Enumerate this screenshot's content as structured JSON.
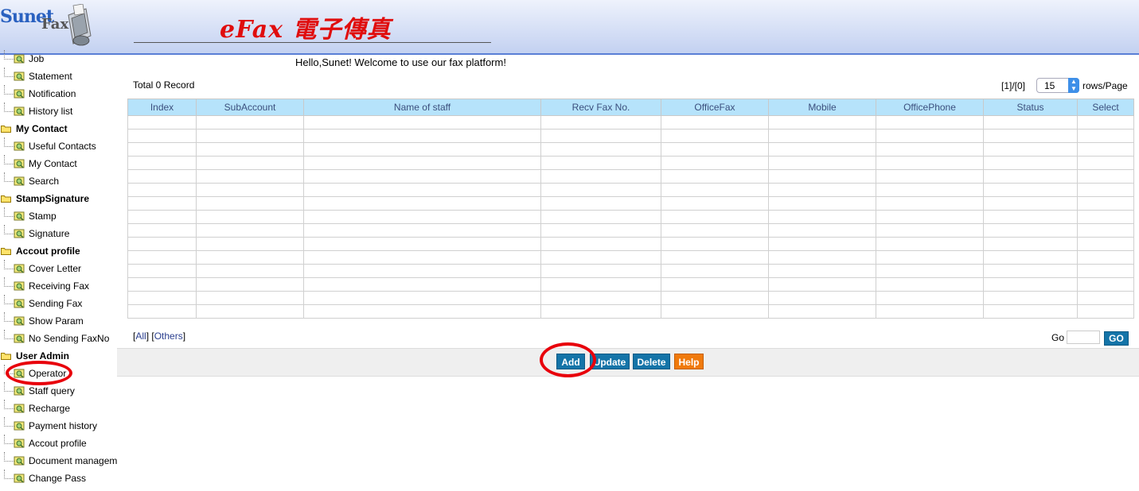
{
  "header": {
    "logo_text_1": "Sunet",
    "logo_text_2": "Fax",
    "title": "eFax 電子傳真"
  },
  "sidebar": {
    "rows": [
      {
        "type": "item",
        "label": "Job"
      },
      {
        "type": "item",
        "label": "Statement"
      },
      {
        "type": "item",
        "label": "Notification"
      },
      {
        "type": "item",
        "label": "History list"
      },
      {
        "type": "group",
        "label": "My Contact"
      },
      {
        "type": "item",
        "label": "Useful Contacts"
      },
      {
        "type": "item",
        "label": "My Contact"
      },
      {
        "type": "item",
        "label": "Search"
      },
      {
        "type": "group",
        "label": "StampSignature"
      },
      {
        "type": "item",
        "label": "Stamp"
      },
      {
        "type": "item",
        "label": "Signature"
      },
      {
        "type": "group",
        "label": "Accout profile"
      },
      {
        "type": "item",
        "label": "Cover Letter"
      },
      {
        "type": "item",
        "label": "Receiving Fax"
      },
      {
        "type": "item",
        "label": "Sending Fax"
      },
      {
        "type": "item",
        "label": "Show Param"
      },
      {
        "type": "item",
        "label": "No Sending FaxNo"
      },
      {
        "type": "group",
        "label": "User Admin"
      },
      {
        "type": "item",
        "label": "Operator"
      },
      {
        "type": "item",
        "label": "Staff query"
      },
      {
        "type": "item",
        "label": "Recharge"
      },
      {
        "type": "item",
        "label": "Payment history"
      },
      {
        "type": "item",
        "label": "Accout profile"
      },
      {
        "type": "item",
        "label": "Document managem"
      },
      {
        "type": "item",
        "label": "Change Pass"
      }
    ]
  },
  "main": {
    "greeting": "Hello,Sunet! Welcome to use our fax platform!",
    "total_records": "Total 0 Record",
    "pager_text": "[1]/[0]",
    "rows_per_page_value": "15",
    "rows_per_page_label": "rows/Page",
    "columns": [
      "Index",
      "SubAccount",
      "Name of staff",
      "Recv Fax No.",
      "OfficeFax",
      "Mobile",
      "OfficePhone",
      "Status",
      "Select"
    ],
    "empty_rows": 15,
    "filter_all": "All",
    "filter_others": "Others",
    "go_label": "Go",
    "go_button": "GO",
    "go_input_value": ""
  },
  "actions": {
    "add": "Add",
    "update": "Update",
    "delete": "Delete",
    "help": "Help"
  },
  "colors": {
    "header_accent": "#5a7fd6",
    "title_red": "#e00d0d",
    "table_header": "#b6e3fb",
    "button_blue": "#1474a8",
    "button_orange": "#f07a0c",
    "highlight_ring": "#e8000b"
  }
}
